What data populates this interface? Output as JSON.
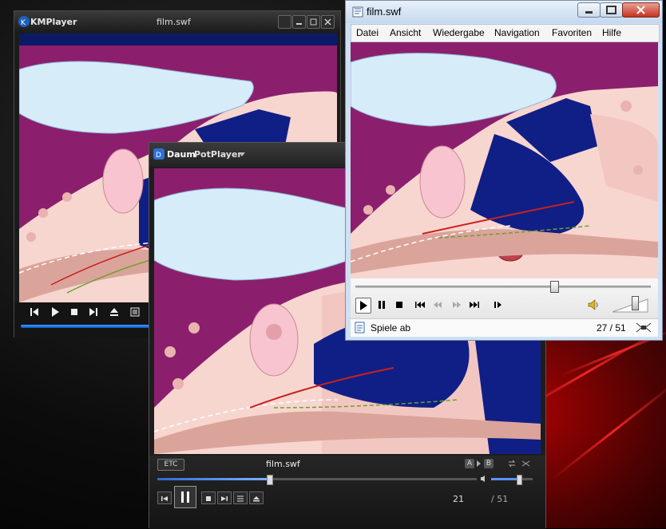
{
  "kmplayer": {
    "app_name": "KMPlayer",
    "file_title": "film.swf"
  },
  "potplayer": {
    "app_name_a": "Daum",
    "app_name_b": "PotPlayer",
    "etc_label": "ETC",
    "file_title": "film.swf",
    "ab_a": "A",
    "ab_b": "B",
    "current_frame": "21",
    "total_frames": "/ 51",
    "seek_fraction": 0.35,
    "volume_fraction": 0.65
  },
  "wmp": {
    "window_title": "film.swf",
    "menu": [
      "Datei",
      "Ansicht",
      "Wiedergabe",
      "Navigation",
      "Favoriten",
      "Hilfe"
    ],
    "status_text": "Spiele ab",
    "frame_counter": "27 / 51",
    "seek_fraction": 0.67,
    "volume_fraction": 0.62
  },
  "colors": {
    "magenta_bg": "#8b1f6e",
    "membrane": "#d7ecf9",
    "tissue": "#f7d6cf",
    "navy": "#101f86",
    "muscle": "#dba49b",
    "desktop_red": "#c80000"
  }
}
